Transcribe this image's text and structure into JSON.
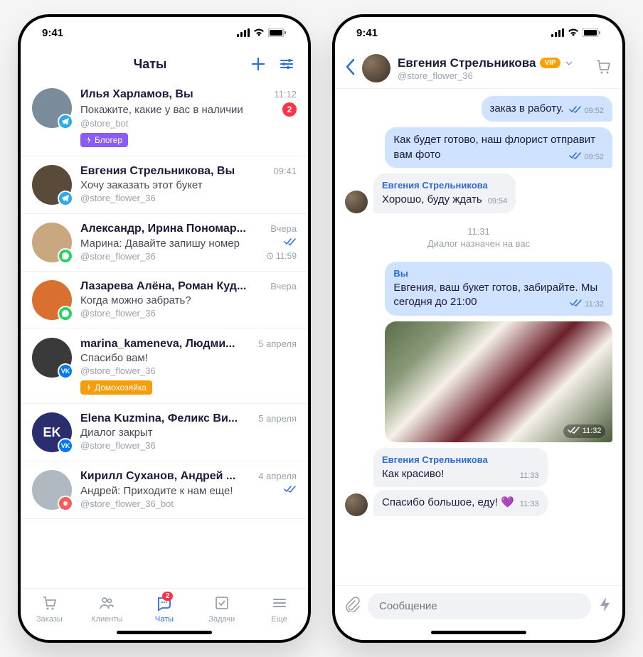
{
  "statusbar": {
    "time": "9:41"
  },
  "screen1": {
    "title": "Чаты",
    "chats": [
      {
        "name": "Илья Харламов, Вы",
        "snippet": "Покажите, какие у вас в наличии",
        "handle": "@store_bot",
        "time": "11:12",
        "unread": "2",
        "tag": "Блогер",
        "tagClass": "tag-purple",
        "net": "tg",
        "avatar": "#7a8b9c",
        "initials": ""
      },
      {
        "name": "Евгения Стрельникова, Вы",
        "snippet": "Хочу заказать этот букет",
        "handle": "@store_flower_36",
        "time": "09:41",
        "net": "tg",
        "avatar": "#5a4a3a",
        "initials": ""
      },
      {
        "name": "Александр, Ирина Пономар...",
        "snippet": "Марина: Давайте запишу номер",
        "handle": "@store_flower_36",
        "time": "Вчера",
        "read": true,
        "timer": "11:59",
        "net": "wa",
        "avatar": "#c9a880",
        "initials": ""
      },
      {
        "name": "Лазарева Алёна, Роман Куд...",
        "snippet": "Когда можно забрать?",
        "handle": "@store_flower_36",
        "time": "Вчера",
        "net": "wa",
        "avatar": "#d97030",
        "initials": ""
      },
      {
        "name": "marina_kameneva, Людми...",
        "snippet": "Спасибо вам!",
        "handle": "@store_flower_36",
        "time": "5 апреля",
        "tag": "Домохозяйка",
        "tagClass": "tag-orange",
        "net": "vk",
        "avatar": "#3a3a3a",
        "initials": ""
      },
      {
        "name": "Elena Kuzmina, Феликс Ви...",
        "snippet": "Диалог закрыт",
        "handle": "@store_flower_36",
        "time": "5 апреля",
        "net": "vk",
        "avatar": "#2a2e6e",
        "initials": "EK"
      },
      {
        "name": "Кирилл Суханов, Андрей ...",
        "snippet": "Андрей: Приходите к нам еще!",
        "handle": "@store_flower_36_bot",
        "time": "4 апреля",
        "read": true,
        "net": "ot",
        "avatar": "#b0b8c0",
        "initials": ""
      }
    ],
    "nav": [
      {
        "label": "Заказы"
      },
      {
        "label": "Клиенты"
      },
      {
        "label": "Чаты",
        "active": true,
        "badge": "2"
      },
      {
        "label": "Задачи"
      },
      {
        "label": "Еще"
      }
    ]
  },
  "screen2": {
    "header": {
      "name": "Евгения Стрельникова",
      "handle": "@store_flower_36",
      "vip": "VIP"
    },
    "items": [
      {
        "type": "out",
        "text": "заказ в работу.",
        "time": "09:52",
        "read": true,
        "first": true
      },
      {
        "type": "out",
        "text": "Как будет готово, наш флорист отправит вам фото",
        "time": "09:52",
        "read": true
      },
      {
        "type": "in",
        "sender": "Евгения Стрельникова",
        "text": "Хорошо, буду ждать",
        "time": "09:54"
      },
      {
        "type": "divider",
        "time": "11:31",
        "text": "Диалог назначен на вас"
      },
      {
        "type": "out",
        "sender": "Вы",
        "text": "Евгения, ваш букет готов, забирайте. Мы сегодня до 21:00",
        "time": "11:32",
        "read": true
      },
      {
        "type": "photo",
        "time": "11:32",
        "read": true
      },
      {
        "type": "in",
        "sender": "Евгения Стрельникова",
        "text": "Как красиво!",
        "time": "11:33",
        "text2": "Спасибо большое, еду! 💜",
        "time2": "11:33"
      }
    ],
    "composer": {
      "placeholder": "Сообщение"
    }
  }
}
